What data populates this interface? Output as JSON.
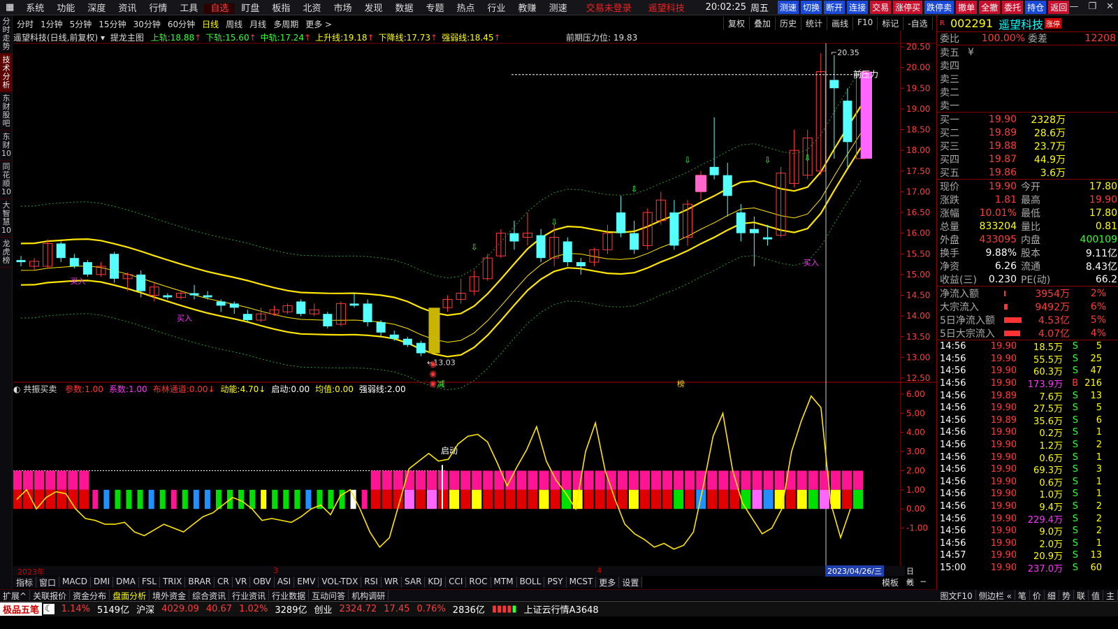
{
  "menu": {
    "items": [
      "系统",
      "功能",
      "深度",
      "资讯",
      "行情",
      "工具",
      "自选",
      "盯盘",
      "板指",
      "北资",
      "市场",
      "发现",
      "数据",
      "专题",
      "热点",
      "行业",
      "教赚",
      "测速"
    ],
    "active_index": 6,
    "hint1": "交易未登录",
    "hint2": "遥望科技",
    "clock": "20:02:25",
    "weekday": "周五",
    "buttons": [
      {
        "label": "测速",
        "color": "blue"
      },
      {
        "label": "切换",
        "color": "blue"
      },
      {
        "label": "断开",
        "color": "blue"
      },
      {
        "label": "连接",
        "color": "blue"
      },
      {
        "label": "交易",
        "color": "red"
      },
      {
        "label": "涨停买",
        "color": "red"
      },
      {
        "label": "跌停卖",
        "color": "blue"
      },
      {
        "label": "撤单",
        "color": "red"
      },
      {
        "label": "全撤",
        "color": "red"
      },
      {
        "label": "委托",
        "color": "red"
      },
      {
        "label": "持仓",
        "color": "blue"
      },
      {
        "label": "返回",
        "color": "red"
      }
    ]
  },
  "vtabs": [
    "分时走势",
    "技术分析",
    "东财股吧",
    "东财10",
    "同花顺10",
    "大智慧10",
    "龙虎榜"
  ],
  "vtab_active": 1,
  "periods": [
    "分时",
    "1分钟",
    "5分钟",
    "15分钟",
    "30分钟",
    "60分钟",
    "日线",
    "周线",
    "月线",
    "多周期",
    "更多 >"
  ],
  "period_active": 6,
  "toolbar": [
    "复权",
    "叠加",
    "历史",
    "统计",
    "画线",
    "F10",
    "标记",
    "-自选",
    "返回"
  ],
  "main_indicator": {
    "title": "遥望科技(日线,前复权)",
    "name": "提龙主图",
    "values": [
      {
        "label": "上轨:",
        "value": "18.88",
        "color": "#3f3"
      },
      {
        "label": "下轨:",
        "value": "15.60",
        "color": "#3f3"
      },
      {
        "label": "中轨:",
        "value": "17.24",
        "color": "#3f3"
      },
      {
        "label": "上升线:",
        "value": "19.18",
        "color": "#ff0"
      },
      {
        "label": "下降线:",
        "value": "17.73",
        "color": "#ff0"
      },
      {
        "label": "强弱线:",
        "value": "18.45",
        "color": "#ff0"
      }
    ],
    "pressure_label": "前期压力位: 19.83",
    "pressure_tag": "前压力",
    "high_label": "20.35",
    "low_label": "13.03"
  },
  "price_axis": [
    "20.50",
    "20.00",
    "19.50",
    "19.00",
    "18.50",
    "18.00",
    "17.50",
    "17.00",
    "16.50",
    "16.00",
    "15.50",
    "15.00",
    "14.50",
    "14.00",
    "13.50",
    "13.00",
    "12.50"
  ],
  "sub_indicator": {
    "name": "共振买卖",
    "values": [
      {
        "label": "参数:",
        "value": "1.00",
        "color": "#f33"
      },
      {
        "label": "系数:",
        "value": "1.00",
        "color": "#f3f"
      },
      {
        "label": "布林通道:",
        "value": "0.00↓",
        "color": "#f33"
      },
      {
        "label": "动能:",
        "value": "4.70↓",
        "color": "#ff0"
      },
      {
        "label": "启动:",
        "value": "0.00",
        "color": "#fff"
      },
      {
        "label": "均值:",
        "value": "0.00",
        "color": "#ff0"
      },
      {
        "label": "强弱线:",
        "value": "2.00",
        "color": "#fff"
      }
    ],
    "start_label": "启动"
  },
  "sub_axis": [
    "6.00",
    "5.00",
    "4.00",
    "3.00",
    "2.00",
    "1.00",
    "0.00",
    "-1.00"
  ],
  "chart_labels": {
    "buy": "买入",
    "reduce": "减",
    "bang": "榜"
  },
  "xaxis": {
    "left": "2023年",
    "m3": "3",
    "m4": "4",
    "cursor": "2023/04/26/三",
    "period": "日线"
  },
  "indicators": [
    "指标",
    "窗口",
    "MACD",
    "DMI",
    "DMA",
    "FSL",
    "TRIX",
    "BRAR",
    "CR",
    "VR",
    "OBV",
    "ASI",
    "EMV",
    "VOL-TDX",
    "RSI",
    "WR",
    "SAR",
    "KDJ",
    "CCI",
    "ROC",
    "MTM",
    "BOLL",
    "PSY",
    "MCST",
    "更多",
    "设置"
  ],
  "indicator_right": [
    "模板",
    "+",
    "−"
  ],
  "fbar": [
    "扩展^",
    "关联报价",
    "资金分布",
    "盘面分析",
    "境外资金",
    "综合资讯",
    "行业资讯",
    "行业数据",
    "互动问答",
    "机构调研"
  ],
  "fbar_right": [
    "图文F10",
    "侧边栏 «",
    "笔",
    "价",
    "细",
    "势",
    "联",
    "值",
    "主"
  ],
  "status": {
    "app": "极品五笔",
    "pct1": "1.14%",
    "amt1": "5149亿",
    "hs_name": "沪深",
    "hs_val": "4029.09",
    "hs_chg": "40.67",
    "hs_pct": "1.02%",
    "hs_amt": "3289亿",
    "cy_name": "创业",
    "cy_val": "2324.72",
    "cy_chg": "17.45",
    "cy_pct": "0.76%",
    "cy_amt": "2836亿",
    "cloud": "上证云行情A3648"
  },
  "quote": {
    "code": "002291",
    "name": "遥望科技",
    "badge": "涨停",
    "weibi_label": "委比",
    "weibi": "100.00%",
    "weicha_label": "委差",
    "weicha": "12208",
    "sells": [
      {
        "label": "卖五",
        "price": "¥",
        "vol": ""
      },
      {
        "label": "卖四",
        "price": "",
        "vol": ""
      },
      {
        "label": "卖三",
        "price": "",
        "vol": ""
      },
      {
        "label": "卖二",
        "price": "",
        "vol": ""
      },
      {
        "label": "卖一",
        "price": "",
        "vol": ""
      }
    ],
    "buys": [
      {
        "label": "买一",
        "price": "19.90",
        "vol": "2328万"
      },
      {
        "label": "买二",
        "price": "19.89",
        "vol": "28.6万"
      },
      {
        "label": "买三",
        "price": "19.88",
        "vol": "23.7万"
      },
      {
        "label": "买四",
        "price": "19.87",
        "vol": "44.9万"
      },
      {
        "label": "买五",
        "price": "19.86",
        "vol": "3.6万"
      }
    ],
    "stats": [
      {
        "l1": "现价",
        "v1": "19.90",
        "c1": "red",
        "l2": "今开",
        "v2": "17.80",
        "c2": "yel"
      },
      {
        "l1": "涨跌",
        "v1": "1.81",
        "c1": "red",
        "l2": "最高",
        "v2": "19.90",
        "c2": "red"
      },
      {
        "l1": "涨幅",
        "v1": "10.01%",
        "c1": "red",
        "l2": "最低",
        "v2": "17.80",
        "c2": "yel"
      },
      {
        "l1": "总量",
        "v1": "833204",
        "c1": "yel",
        "l2": "量比",
        "v2": "0.81",
        "c2": "yel"
      },
      {
        "l1": "外盘",
        "v1": "433095",
        "c1": "red",
        "l2": "内盘",
        "v2": "400109",
        "c2": "grn"
      },
      {
        "l1": "换手",
        "v1": "9.88%",
        "c1": "wht",
        "l2": "股本",
        "v2": "9.11亿",
        "c2": "wht"
      },
      {
        "l1": "净资",
        "v1": "6.26",
        "c1": "wht",
        "l2": "流通",
        "v2": "8.43亿",
        "c2": "wht"
      },
      {
        "l1": "收益(三)",
        "v1": "0.230",
        "c1": "wht",
        "l2": "PE(动)",
        "v2": "66.2",
        "c2": "wht"
      }
    ],
    "flows": [
      {
        "label": "净流入额",
        "value": "3954万",
        "pct": "2%",
        "bar": 0.05
      },
      {
        "label": "大宗流入",
        "value": "9492万",
        "pct": "6%",
        "bar": 0.12
      },
      {
        "label": "5日净流入额",
        "value": "4.53亿",
        "pct": "5%",
        "bar": 0.6
      },
      {
        "label": "5日大宗流入",
        "value": "4.07亿",
        "pct": "4%",
        "bar": 0.55
      }
    ],
    "ticks": [
      {
        "t": "14:56",
        "p": "19.90",
        "v": "18.5万",
        "d": "S",
        "n": "5"
      },
      {
        "t": "14:56",
        "p": "19.90",
        "v": "55.5万",
        "d": "S",
        "n": "25"
      },
      {
        "t": "14:56",
        "p": "19.90",
        "v": "60.3万",
        "d": "S",
        "n": "47"
      },
      {
        "t": "14:56",
        "p": "19.90",
        "v": "173.9万",
        "d": "B",
        "n": "216"
      },
      {
        "t": "14:56",
        "p": "19.89",
        "v": "7.6万",
        "d": "S",
        "n": "13"
      },
      {
        "t": "14:56",
        "p": "19.90",
        "v": "27.5万",
        "d": "S",
        "n": "5"
      },
      {
        "t": "14:56",
        "p": "19.89",
        "v": "35.6万",
        "d": "S",
        "n": "6"
      },
      {
        "t": "14:56",
        "p": "19.90",
        "v": "0.2万",
        "d": "S",
        "n": "1"
      },
      {
        "t": "14:56",
        "p": "19.90",
        "v": "1.2万",
        "d": "S",
        "n": "2"
      },
      {
        "t": "14:56",
        "p": "19.90",
        "v": "0.6万",
        "d": "S",
        "n": "1"
      },
      {
        "t": "14:56",
        "p": "19.90",
        "v": "69.3万",
        "d": "S",
        "n": "3"
      },
      {
        "t": "14:56",
        "p": "19.90",
        "v": "0.6万",
        "d": "S",
        "n": "1"
      },
      {
        "t": "14:56",
        "p": "19.90",
        "v": "1.0万",
        "d": "S",
        "n": "1"
      },
      {
        "t": "14:56",
        "p": "19.90",
        "v": "9.4万",
        "d": "S",
        "n": "2"
      },
      {
        "t": "14:56",
        "p": "19.90",
        "v": "229.4万",
        "d": "S",
        "n": "2"
      },
      {
        "t": "14:56",
        "p": "19.90",
        "v": "9.0万",
        "d": "S",
        "n": "2"
      },
      {
        "t": "14:56",
        "p": "19.90",
        "v": "2.0万",
        "d": "S",
        "n": "1"
      },
      {
        "t": "14:57",
        "p": "19.90",
        "v": "20.9万",
        "d": "S",
        "n": "13"
      },
      {
        "t": "15:00",
        "p": "19.90",
        "v": "237.0万",
        "d": "S",
        "n": "60"
      }
    ]
  },
  "colors": {
    "up": "#ff3c3c",
    "down": "#55ffff",
    "accent": "#ff0",
    "band": "#ffd700"
  },
  "candles": [
    {
      "o": 15.35,
      "c": 15.3,
      "h": 15.45,
      "l": 15.2
    },
    {
      "o": 15.2,
      "c": 15.32,
      "h": 15.4,
      "l": 15.1
    },
    {
      "o": 15.2,
      "c": 15.75,
      "h": 15.85,
      "l": 15.15
    },
    {
      "o": 15.75,
      "c": 15.4,
      "h": 15.8,
      "l": 15.3
    },
    {
      "o": 15.4,
      "c": 15.2,
      "h": 15.5,
      "l": 15.15
    },
    {
      "o": 15.3,
      "c": 15.0,
      "h": 15.35,
      "l": 14.95
    },
    {
      "o": 15.0,
      "c": 15.2,
      "h": 15.3,
      "l": 14.95
    },
    {
      "o": 15.5,
      "c": 14.9,
      "h": 15.55,
      "l": 14.8
    },
    {
      "o": 14.9,
      "c": 15.0,
      "h": 15.05,
      "l": 14.6
    },
    {
      "o": 15.0,
      "c": 14.6,
      "h": 15.1,
      "l": 14.45
    },
    {
      "o": 14.5,
      "c": 14.7,
      "h": 14.8,
      "l": 14.35
    },
    {
      "o": 14.5,
      "c": 14.45,
      "h": 14.55,
      "l": 14.4
    },
    {
      "o": 14.45,
      "c": 14.55,
      "h": 14.6,
      "l": 14.4
    },
    {
      "o": 14.55,
      "c": 14.5,
      "h": 14.75,
      "l": 14.4
    },
    {
      "o": 14.5,
      "c": 14.45,
      "h": 14.6,
      "l": 14.4
    },
    {
      "o": 14.35,
      "c": 14.25,
      "h": 14.4,
      "l": 14.1
    },
    {
      "o": 14.3,
      "c": 14.2,
      "h": 14.35,
      "l": 14.05
    },
    {
      "o": 14.05,
      "c": 13.9,
      "h": 14.15,
      "l": 13.85
    },
    {
      "o": 13.9,
      "c": 14.05,
      "h": 14.2,
      "l": 13.85
    },
    {
      "o": 14.05,
      "c": 14.15,
      "h": 14.25,
      "l": 14.0
    },
    {
      "o": 14.1,
      "c": 14.25,
      "h": 14.3,
      "l": 14.05
    },
    {
      "o": 14.35,
      "c": 14.05,
      "h": 14.4,
      "l": 14.0
    },
    {
      "o": 14.05,
      "c": 14.15,
      "h": 14.3,
      "l": 14.0
    },
    {
      "o": 14.05,
      "c": 13.75,
      "h": 14.1,
      "l": 13.7
    },
    {
      "o": 13.8,
      "c": 14.3,
      "h": 14.35,
      "l": 13.75
    },
    {
      "o": 14.3,
      "c": 14.25,
      "h": 14.55,
      "l": 14.2
    },
    {
      "o": 14.3,
      "c": 13.85,
      "h": 14.4,
      "l": 13.75
    },
    {
      "o": 13.85,
      "c": 13.6,
      "h": 13.9,
      "l": 13.5
    },
    {
      "o": 13.55,
      "c": 13.45,
      "h": 13.65,
      "l": 13.4
    },
    {
      "o": 13.45,
      "c": 13.3,
      "h": 13.5,
      "l": 13.25
    },
    {
      "o": 13.35,
      "c": 13.1,
      "h": 13.4,
      "l": 13.03
    },
    {
      "o": 13.2,
      "c": 13.95,
      "h": 14.0,
      "l": 13.15
    },
    {
      "o": 14.2,
      "c": 14.4,
      "h": 14.5,
      "l": 14.1
    },
    {
      "o": 14.4,
      "c": 14.55,
      "h": 14.9,
      "l": 14.3
    },
    {
      "o": 14.6,
      "c": 14.95,
      "h": 15.1,
      "l": 14.5
    },
    {
      "o": 14.9,
      "c": 15.4,
      "h": 15.5,
      "l": 14.85
    },
    {
      "o": 15.45,
      "c": 16.0,
      "h": 16.1,
      "l": 15.4
    },
    {
      "o": 16.0,
      "c": 15.8,
      "h": 16.3,
      "l": 15.6
    },
    {
      "o": 15.9,
      "c": 16.0,
      "h": 16.5,
      "l": 15.7
    },
    {
      "o": 15.95,
      "c": 15.4,
      "h": 16.1,
      "l": 15.3
    },
    {
      "o": 15.4,
      "c": 15.9,
      "h": 16.2,
      "l": 15.2
    },
    {
      "o": 15.8,
      "c": 15.3,
      "h": 15.9,
      "l": 15.2
    },
    {
      "o": 15.3,
      "c": 15.2,
      "h": 15.4,
      "l": 15.0
    },
    {
      "o": 15.3,
      "c": 15.6,
      "h": 15.65,
      "l": 15.2
    },
    {
      "o": 15.6,
      "c": 16.0,
      "h": 16.2,
      "l": 15.5
    },
    {
      "o": 16.5,
      "c": 16.0,
      "h": 16.9,
      "l": 15.9
    },
    {
      "o": 16.0,
      "c": 15.6,
      "h": 16.3,
      "l": 15.5
    },
    {
      "o": 15.7,
      "c": 16.5,
      "h": 16.6,
      "l": 15.6
    },
    {
      "o": 16.3,
      "c": 16.8,
      "h": 17.0,
      "l": 16.2
    },
    {
      "o": 16.5,
      "c": 15.7,
      "h": 16.8,
      "l": 15.6
    },
    {
      "o": 15.9,
      "c": 16.7,
      "h": 16.8,
      "l": 15.7
    },
    {
      "o": 17.0,
      "c": 17.4,
      "h": 17.5,
      "l": 16.8
    },
    {
      "o": 17.6,
      "c": 17.4,
      "h": 18.8,
      "l": 17.3
    },
    {
      "o": 17.4,
      "c": 16.9,
      "h": 17.7,
      "l": 16.4
    },
    {
      "o": 16.5,
      "c": 16.0,
      "h": 16.7,
      "l": 15.8
    },
    {
      "o": 16.1,
      "c": 16.0,
      "h": 16.4,
      "l": 15.2
    },
    {
      "o": 15.9,
      "c": 15.85,
      "h": 16.2,
      "l": 15.7
    },
    {
      "o": 15.95,
      "c": 17.45,
      "h": 17.6,
      "l": 15.9
    },
    {
      "o": 17.2,
      "c": 18.0,
      "h": 18.5,
      "l": 17.1
    },
    {
      "o": 17.4,
      "c": 18.3,
      "h": 18.5,
      "l": 17.3
    },
    {
      "o": 17.5,
      "c": 19.9,
      "h": 20.35,
      "l": 17.4
    },
    {
      "o": 19.7,
      "c": 19.5,
      "h": 20.3,
      "l": 17.8
    },
    {
      "o": 19.2,
      "c": 18.2,
      "h": 19.5,
      "l": 17.6
    },
    {
      "o": 17.8,
      "c": 19.9,
      "h": 19.9,
      "l": 17.8
    }
  ],
  "sub_line": [
    0.5,
    1.0,
    0.0,
    0.6,
    0.9,
    0.8,
    0.0,
    -0.5,
    -0.6,
    -0.8,
    -0.8,
    -0.7,
    -1.2,
    -1.4,
    -1.1,
    -0.8,
    -1.0,
    -1.2,
    -0.8,
    -0.4,
    -0.2,
    0.2,
    0.6,
    0.4,
    0.0,
    -0.6,
    -0.5,
    -0.6,
    -0.7,
    -0.4,
    0.0,
    0.2,
    -0.3,
    0.7,
    1.0,
    0.0,
    -1.2,
    -2.0,
    -1.5,
    0.3,
    2.1,
    2.5,
    2.9,
    2.5,
    2.6,
    3.4,
    3.8,
    3.9,
    3.5,
    2.4,
    1.2,
    2.2,
    3.1,
    4.3,
    2.5,
    1.5,
    0.8,
    0.0,
    3.0,
    4.5,
    2.0,
    0.5,
    -0.8,
    -1.3,
    -1.6,
    -2.0,
    -1.8,
    -2.1,
    -1.9,
    -1.2,
    1.2,
    3.8,
    5.0,
    2.0,
    0.3,
    -0.5,
    -1.3,
    -1.0,
    0.0,
    3.0,
    4.6,
    5.9,
    5.3,
    0.3,
    -1.5,
    0.0
  ],
  "sub_bars": "RRRRRRRRCGGGBGRGBBGGGGYGGGBGGGWRRRRPRPRYRYRRRRRYRGYRRRRYRRRGRBRRRGPBYRYGPYRG"
}
